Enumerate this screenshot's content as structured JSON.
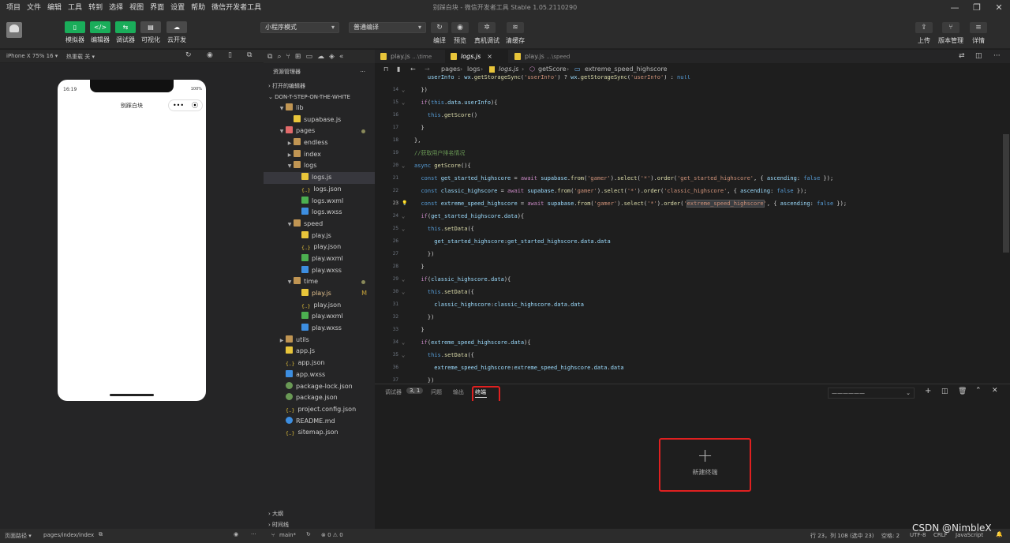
{
  "window": {
    "menu": [
      "项目",
      "文件",
      "编辑",
      "工具",
      "转到",
      "选择",
      "视图",
      "界面",
      "设置",
      "帮助",
      "微信开发者工具"
    ],
    "title": "别踩白块 - 微信开发者工具 Stable 1.05.2110290",
    "controls": [
      "—",
      "❐",
      "✕"
    ]
  },
  "toolbar": {
    "left_buttons": [
      {
        "label": "模拟器",
        "icon": "▯"
      },
      {
        "label": "编辑器",
        "icon": "</>"
      },
      {
        "label": "调试器",
        "icon": "⇆"
      },
      {
        "label": "可视化",
        "icon": "▤"
      },
      {
        "label": "云开发",
        "icon": "☁"
      }
    ],
    "mode_select": "小程序模式",
    "compile_select": "普通编译",
    "center_buttons": [
      {
        "label": "编译",
        "icon": "↻"
      },
      {
        "label": "预览",
        "icon": "◉"
      },
      {
        "label": "真机调试",
        "icon": "✲"
      },
      {
        "label": "清缓存",
        "icon": "≋"
      }
    ],
    "right_buttons": [
      {
        "label": "上传",
        "icon": "⇪"
      },
      {
        "label": "版本管理",
        "icon": "⑂"
      },
      {
        "label": "详情",
        "icon": "≡"
      }
    ]
  },
  "simulator": {
    "device": "iPhone X 75% 16 ▾",
    "hot_reload": "热重载 关 ▾",
    "time": "16:19",
    "battery": "100%",
    "page_title": "别踩白块",
    "capsule_dots": "•••"
  },
  "explorer": {
    "title": "资源管理器",
    "more": "···",
    "open_editors": "打开的编辑器",
    "project": "DON-T-STEP-ON-THE-WHITE",
    "items": [
      {
        "name": "lib",
        "type": "folder",
        "depth": 1,
        "open": true
      },
      {
        "name": "supabase.js",
        "type": "js",
        "depth": 2
      },
      {
        "name": "pages",
        "type": "folder-pink",
        "depth": 1,
        "open": true,
        "dot": true
      },
      {
        "name": "endless",
        "type": "folder",
        "depth": 2,
        "open": false
      },
      {
        "name": "index",
        "type": "folder",
        "depth": 2,
        "open": false
      },
      {
        "name": "logs",
        "type": "folder",
        "depth": 2,
        "open": true
      },
      {
        "name": "logs.js",
        "type": "js",
        "depth": 3,
        "active": true
      },
      {
        "name": "logs.json",
        "type": "json",
        "depth": 3
      },
      {
        "name": "logs.wxml",
        "type": "wxml",
        "depth": 3
      },
      {
        "name": "logs.wxss",
        "type": "wxss",
        "depth": 3
      },
      {
        "name": "speed",
        "type": "folder",
        "depth": 2,
        "open": true
      },
      {
        "name": "play.js",
        "type": "js",
        "depth": 3
      },
      {
        "name": "play.json",
        "type": "json",
        "depth": 3
      },
      {
        "name": "play.wxml",
        "type": "wxml",
        "depth": 3
      },
      {
        "name": "play.wxss",
        "type": "wxss",
        "depth": 3
      },
      {
        "name": "time",
        "type": "folder",
        "depth": 2,
        "open": true,
        "dot": true
      },
      {
        "name": "play.js",
        "type": "js",
        "depth": 3,
        "badge": "M",
        "modified": true
      },
      {
        "name": "play.json",
        "type": "json",
        "depth": 3
      },
      {
        "name": "play.wxml",
        "type": "wxml",
        "depth": 3
      },
      {
        "name": "play.wxss",
        "type": "wxss",
        "depth": 3
      },
      {
        "name": "utils",
        "type": "folder",
        "depth": 1,
        "open": false
      },
      {
        "name": "app.js",
        "type": "js",
        "depth": 1
      },
      {
        "name": "app.json",
        "type": "json",
        "depth": 1
      },
      {
        "name": "app.wxss",
        "type": "wxss",
        "depth": 1
      },
      {
        "name": "package-lock.json",
        "type": "lock",
        "depth": 1
      },
      {
        "name": "package.json",
        "type": "lock",
        "depth": 1
      },
      {
        "name": "project.config.json",
        "type": "json",
        "depth": 1
      },
      {
        "name": "README.md",
        "type": "info",
        "depth": 1
      },
      {
        "name": "sitemap.json",
        "type": "json",
        "depth": 1
      }
    ],
    "outline": "大纲",
    "timeline": "时间线"
  },
  "tabs": [
    {
      "name": "play.js",
      "hint": "...\\time",
      "active": false
    },
    {
      "name": "logs.js",
      "hint": "",
      "active": true,
      "close": "×"
    },
    {
      "name": "play.js",
      "hint": "...\\speed",
      "active": false
    }
  ],
  "tab_extra": "extreme_speed_highscore",
  "breadcrumb": [
    "pages",
    "logs",
    "logs.js",
    "getScore",
    "extreme_speed_highscore"
  ],
  "code_lines": [
    {
      "n": "",
      "html": "    <span class=\"v\">userInfo</span> : <span class=\"v\">wx</span>.<span class=\"f\">getStorageSync</span>(<span class=\"s\">'userInfo'</span>) ? <span class=\"v\">wx</span>.<span class=\"f\">getStorageSync</span>(<span class=\"s\">'userInfo'</span>) : <span class=\"k\">null</span>"
    },
    {
      "n": "14",
      "html": "  })",
      "fold": "⌄"
    },
    {
      "n": "15",
      "html": "  <span class=\"kw\">if</span>(<span class=\"k\">this</span>.<span class=\"v\">data</span>.<span class=\"v\">userInfo</span>){",
      "fold": "⌄"
    },
    {
      "n": "16",
      "html": "    <span class=\"k\">this</span>.<span class=\"f\">getScore</span>()"
    },
    {
      "n": "17",
      "html": "  }"
    },
    {
      "n": "18",
      "html": "},"
    },
    {
      "n": "19",
      "html": "<span class=\"c\">//获取用户排名情况</span>"
    },
    {
      "n": "20",
      "html": "<span class=\"k\">async</span> <span class=\"f\">getScore</span>(){",
      "fold": "⌄"
    },
    {
      "n": "21",
      "html": "  <span class=\"k\">const</span> <span class=\"v\">get_started_highscore</span> = <span class=\"kw\">await</span> <span class=\"v\">supabase</span>.<span class=\"f\">from</span>(<span class=\"s\">'gamer'</span>).<span class=\"f\">select</span>(<span class=\"s\">'*'</span>).<span class=\"f\">order</span>(<span class=\"s\">'get_started_highscore'</span>, { <span class=\"v\">ascending</span>: <span class=\"k\">false</span> });"
    },
    {
      "n": "22",
      "html": "  <span class=\"k\">const</span> <span class=\"v\">classic_highscore</span> = <span class=\"kw\">await</span> <span class=\"v\">supabase</span>.<span class=\"f\">from</span>(<span class=\"s\">'gamer'</span>).<span class=\"f\">select</span>(<span class=\"s\">'*'</span>).<span class=\"f\">order</span>(<span class=\"s\">'classic_highscore'</span>, { <span class=\"v\">ascending</span>: <span class=\"k\">false</span> });"
    },
    {
      "n": "23",
      "html": "  <span class=\"k\">const</span> <span class=\"v\">extreme_speed_highscore</span> = <span class=\"kw\">await</span> <span class=\"v\">supabase</span>.<span class=\"f\">from</span>(<span class=\"s\">'gamer'</span>).<span class=\"f\">select</span>(<span class=\"s\">'*'</span>).<span class=\"f\">order</span>(<span class=\"s\">'<span class=\"hl\">extreme_speed_highscore</span>'</span>, { <span class=\"v\">ascending</span>: <span class=\"k\">false</span> });",
      "bulb": true
    },
    {
      "n": "24",
      "html": "  <span class=\"kw\">if</span>(<span class=\"v\">get_started_highscore</span>.<span class=\"v\">data</span>){",
      "fold": "⌄"
    },
    {
      "n": "25",
      "html": "    <span class=\"k\">this</span>.<span class=\"f\">setData</span>({",
      "fold": "⌄"
    },
    {
      "n": "26",
      "html": "      <span class=\"v\">get_started_highscore</span>:<span class=\"v\">get_started_highscore</span>.<span class=\"v\">data</span>.<span class=\"v\">data</span>"
    },
    {
      "n": "27",
      "html": "    })"
    },
    {
      "n": "28",
      "html": "  }"
    },
    {
      "n": "29",
      "html": "  <span class=\"kw\">if</span>(<span class=\"v\">classic_highscore</span>.<span class=\"v\">data</span>){",
      "fold": "⌄"
    },
    {
      "n": "30",
      "html": "    <span class=\"k\">this</span>.<span class=\"f\">setData</span>({",
      "fold": "⌄"
    },
    {
      "n": "31",
      "html": "      <span class=\"v\">classic_highscore</span>:<span class=\"v\">classic_highscore</span>.<span class=\"v\">data</span>.<span class=\"v\">data</span>"
    },
    {
      "n": "32",
      "html": "    })"
    },
    {
      "n": "33",
      "html": "  }"
    },
    {
      "n": "34",
      "html": "  <span class=\"kw\">if</span>(<span class=\"v\">extreme_speed_highscore</span>.<span class=\"v\">data</span>){",
      "fold": "⌄"
    },
    {
      "n": "35",
      "html": "    <span class=\"k\">this</span>.<span class=\"f\">setData</span>({",
      "fold": "⌄"
    },
    {
      "n": "36",
      "html": "      <span class=\"v\">extreme_speed_highscore</span>:<span class=\"v\">extreme_speed_highscore</span>.<span class=\"v\">data</span>.<span class=\"v\">data</span>"
    },
    {
      "n": "37",
      "html": "    })"
    }
  ],
  "panel": {
    "tabs": [
      {
        "label": "调试器",
        "badge": "3, 1"
      },
      {
        "label": "问题"
      },
      {
        "label": "输出"
      },
      {
        "label": "终端",
        "active": true
      }
    ],
    "terminal_select": "——————",
    "new_terminal_label": "新建终端",
    "plus": "+"
  },
  "status": {
    "page_path_label": "页面路径 ▾",
    "page_path": "pages/index/index",
    "branch": "main*",
    "errors": "⊗ 0 ⚠ 0",
    "cursor": "行 23，列 108 (选中 23)",
    "spaces": "空格: 2",
    "encoding": "UTF-8",
    "eol": "CRLF",
    "language": "JavaScript",
    "watermark": "CSDN @NimbleX"
  },
  "colors": {
    "accent_green": "#1aad5a",
    "highlight_red": "#e02020"
  }
}
